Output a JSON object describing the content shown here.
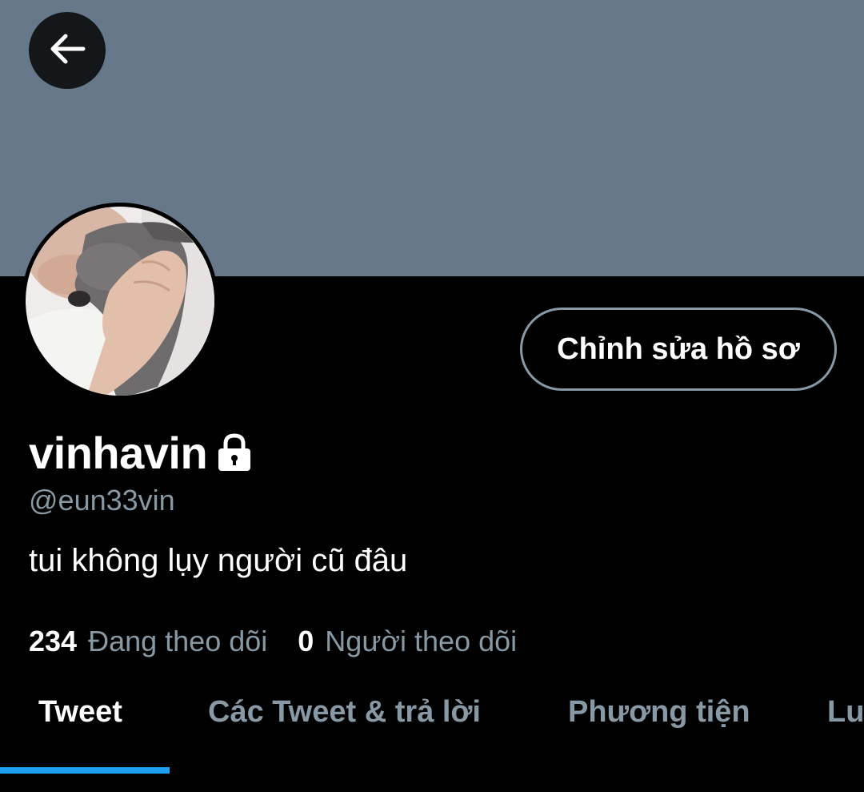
{
  "profile": {
    "display_name": "vinhavin",
    "handle": "@eun33vin",
    "bio": "tui không lụy người cũ đâu",
    "edit_button_label": "Chỉnh sửa hồ sơ"
  },
  "stats": {
    "following_count": "234",
    "following_label": "Đang theo dõi",
    "followers_count": "0",
    "followers_label": "Người theo dõi"
  },
  "tabs": [
    {
      "label": "Tweet",
      "active": true
    },
    {
      "label": "Các Tweet & trả lời",
      "active": false
    },
    {
      "label": "Phương tiện",
      "active": false
    },
    {
      "label": "Lu",
      "active": false
    }
  ],
  "icons": {
    "back": "arrow-left-icon",
    "protected": "lock-icon"
  },
  "colors": {
    "banner": "#66788a",
    "background": "#000000",
    "secondary_text": "#8899a6",
    "accent": "#1da1f2"
  }
}
